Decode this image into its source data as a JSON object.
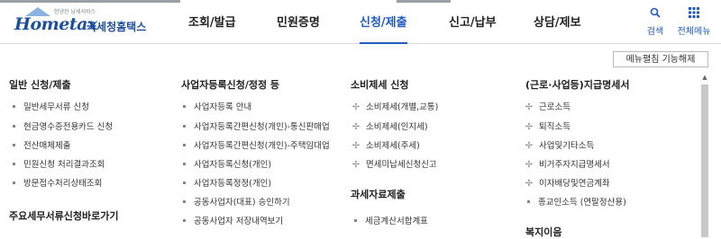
{
  "logo": {
    "slogan": "안녕한 납세서비스",
    "wordmark": "Hometax",
    "name": "국세청홈택스"
  },
  "nav": [
    {
      "label": "조회/발급",
      "active": false
    },
    {
      "label": "민원증명",
      "active": false
    },
    {
      "label": "신청/제출",
      "active": true
    },
    {
      "label": "신고/납부",
      "active": false
    },
    {
      "label": "상담/제보",
      "active": false
    }
  ],
  "utility": {
    "search_label": "검색",
    "menu_label": "전체메뉴"
  },
  "menu_toggle_label": "메뉴펼침 기능해제",
  "columns": [
    {
      "title": "일반 신청/제출",
      "items": [
        "일반세무서류 신청",
        "현금영수증전용카드 신청",
        "전산매체제출",
        "민원신청 처리결과조회",
        "방문접수처리상태조회"
      ],
      "subtitle": "주요세무서류신청바로가기"
    },
    {
      "title": "사업자등록신청/정정 등",
      "items": [
        "사업자등록 안내",
        "사업자등록간편신청(개인)-통신판매업",
        "사업자등록간편신청(개인)-주택임대업",
        "사업자등록신청(개인)",
        "사업자등록정정(개인)",
        "공동사업자(대표) 승인하기",
        "공동사업자 저장내역보기"
      ]
    },
    {
      "title": "소비제세 신청",
      "items": [
        "소비제세(개별,교통)",
        "소비제세(인지세)",
        "소비제세(주세)",
        "면세미납세신청신고"
      ],
      "subtitle": "과세자료제출",
      "sub_items": [
        "세금계산서합계표"
      ]
    },
    {
      "title": "(근로·사업등)지급명세서",
      "items": [
        "근로소득",
        "퇴직소득",
        "사업및기타소득",
        "비거주자지급명세서",
        "이자배당및연금계좌",
        "종교인소득 (연말정산용)"
      ],
      "subtitle": "복지이음"
    }
  ],
  "colors": {
    "accent": "#1f5bc2",
    "logo": "#1b4f9c"
  }
}
